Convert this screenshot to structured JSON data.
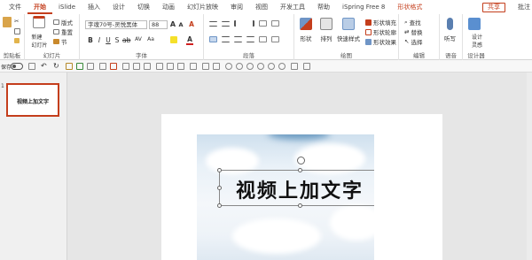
{
  "tabs": [
    "文件",
    "开始",
    "iSlide",
    "插入",
    "设计",
    "切换",
    "动画",
    "幻灯片放映",
    "审阅",
    "视图",
    "开发工具",
    "帮助",
    "iSpring Free 8",
    "形状格式"
  ],
  "share_label": "共享",
  "comment_label": "批注",
  "ribbon": {
    "clipboard": {
      "label": "剪贴板",
      "paste": "粘贴"
    },
    "slides": {
      "label": "幻灯片",
      "new_slide": "新建\n幻灯片",
      "layout": "版式",
      "reset": "重置",
      "section": "节"
    },
    "font": {
      "label": "字体",
      "font_name": "字魂70号-灵悦黑体",
      "font_size": "88"
    },
    "paragraph": {
      "label": "段落"
    },
    "drawing": {
      "label": "绘图",
      "shape": "形状",
      "arrange": "排列",
      "quick_styles": "快速样式",
      "fill": "形状填充",
      "outline": "形状轮廓",
      "effects": "形状效果"
    },
    "editing": {
      "label": "编辑",
      "find": "查找",
      "replace": "替换",
      "select": "选择"
    },
    "voice": {
      "label": "语音",
      "dictate": "听写"
    },
    "designer": {
      "label": "设计器",
      "ideas": "设计\n灵感"
    }
  },
  "qat": {
    "autosave": "保存"
  },
  "thumbnail": {
    "number": "1",
    "text": "视频上加文字"
  },
  "slide": {
    "title": "视频上加文字"
  },
  "colors": {
    "accent": "#c43e1c",
    "highlight": "#f5e02a",
    "font_color": "#d12020"
  }
}
